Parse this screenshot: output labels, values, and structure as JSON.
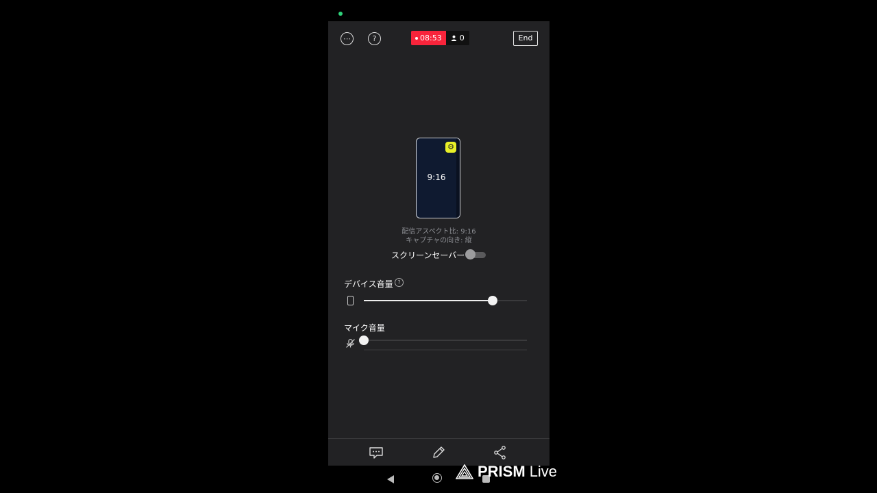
{
  "header": {
    "live_timer": "08:53",
    "viewer_count": "0",
    "end_label": "End"
  },
  "preview": {
    "aspect_ratio": "9:16",
    "caption_aspect": "配信アスペクト比: 9:16",
    "caption_orientation": "キャプチャの向き: 縦"
  },
  "screen_saver": {
    "label": "スクリーンセーバー",
    "enabled": false
  },
  "device_volume": {
    "label": "デバイス音量",
    "level_percent": 79
  },
  "mic_volume": {
    "label": "マイク音量",
    "level_percent": 0
  },
  "colors": {
    "live_red": "#f8243b",
    "gear_yellow": "#e8f028",
    "panel_bg": "#222224"
  },
  "watermark": {
    "brand_bold": "PRISM",
    "brand_light": "Live"
  }
}
